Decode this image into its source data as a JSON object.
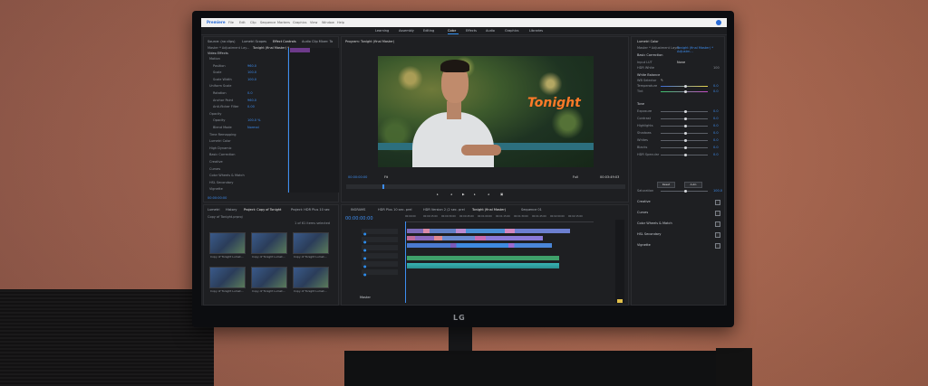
{
  "app": {
    "name": "Premiere",
    "menu": [
      "File",
      "Edit",
      "Clip",
      "Sequence",
      "Markers",
      "Graphics",
      "View",
      "Window",
      "Help"
    ]
  },
  "workspaces": [
    "Learning",
    "Assembly",
    "Editing",
    "Color",
    "Effects",
    "Audio",
    "Graphics",
    "Libraries"
  ],
  "active_workspace": "Color",
  "effect_controls": {
    "tabs": [
      "Source: (no clips)",
      "Lumetri Scopes",
      "Effect Controls",
      "Audio Clip Mixer: To"
    ],
    "master": "Master * Adjustment Lay...",
    "clip": "Tonight (final Master) *",
    "section": "Video Effects",
    "rows": [
      {
        "label": "Motion",
        "value": ""
      },
      {
        "label": "Position",
        "value": "960.0"
      },
      {
        "label": "Scale",
        "value": "100.0"
      },
      {
        "label": "Scale Width",
        "value": "100.0"
      },
      {
        "label": "Uniform Scale",
        "value": ""
      },
      {
        "label": "Rotation",
        "value": "0.0"
      },
      {
        "label": "Anchor Point",
        "value": "960.0"
      },
      {
        "label": "Anti-flicker Filter",
        "value": "0.00"
      },
      {
        "label": "Opacity",
        "value": ""
      },
      {
        "label": "Opacity",
        "value": "100.0 %"
      },
      {
        "label": "Blend Mode",
        "value": "Normal"
      },
      {
        "label": "Time Remapping",
        "value": ""
      },
      {
        "label": "Lumetri Color",
        "value": ""
      },
      {
        "label": "High Dynamic",
        "value": ""
      },
      {
        "label": "Basic Correction",
        "value": ""
      },
      {
        "label": "Creative",
        "value": ""
      },
      {
        "label": "Curves",
        "value": ""
      },
      {
        "label": "Color Wheels & Match",
        "value": ""
      },
      {
        "label": "HSL Secondary",
        "value": ""
      },
      {
        "label": "Vignette",
        "value": ""
      }
    ],
    "timecode": "00:00:00:00"
  },
  "program": {
    "title": "Program: Tonight (final Master)",
    "overlay_title": "Tonight",
    "timecode_left": "00:00:00:00",
    "timecode_right": "00:03:49:03",
    "fit": "Fit",
    "quality": "Full"
  },
  "lumetri": {
    "title": "Lumetri Color",
    "master": "Master * Adjustment Layer",
    "clip": "Tonight (final Master) * Adjustm...",
    "sections": [
      "Basic Correction",
      "Creative",
      "Curves",
      "Color Wheels & Match",
      "HSL Secondary",
      "Vignette"
    ],
    "input_lut": {
      "label": "Input LUT",
      "value": "None"
    },
    "hdr_white": {
      "label": "HDR White",
      "value": "100"
    },
    "white_balance": "White Balance",
    "wb_selector": "WB Selector",
    "tone": "Tone",
    "sliders": [
      {
        "label": "Temperature",
        "value": "0.0",
        "pos": 0.5
      },
      {
        "label": "Tint",
        "value": "0.0",
        "pos": 0.5
      },
      {
        "label": "Exposure",
        "value": "0.0",
        "pos": 0.5
      },
      {
        "label": "Contrast",
        "value": "0.0",
        "pos": 0.5
      },
      {
        "label": "Highlights",
        "value": "0.0",
        "pos": 0.5
      },
      {
        "label": "Shadows",
        "value": "0.0",
        "pos": 0.5
      },
      {
        "label": "Whites",
        "value": "0.0",
        "pos": 0.5
      },
      {
        "label": "Blacks",
        "value": "0.0",
        "pos": 0.5
      },
      {
        "label": "HDR Specular",
        "value": "0.0",
        "pos": 0.5
      }
    ],
    "reset": "Reset",
    "auto": "Auto",
    "saturation": {
      "label": "Saturation",
      "value": "100.0"
    }
  },
  "project": {
    "tabs": [
      "Lumetri",
      "History",
      "Project: Copy of Tonight",
      "Project: HDR Plus 10 sec"
    ],
    "file": "Copy of Tonight.prproj",
    "count": "1 of 61 items selected",
    "thumbs": [
      "Copy of Tonight Lumet...",
      "Copy of Tonight Lumet...",
      "Copy of Tonight Lumet...",
      "Copy of Tonight Lumet...",
      "Copy of Tonight Lumet...",
      "Copy of Tonight Lumet..."
    ]
  },
  "timeline": {
    "tabs": [
      "INGRAMS",
      "HDR Plus 10 sec. prel",
      "HDR Version 2 (2 sec. prel",
      "Tonight (final Master)",
      "Sequence 01"
    ],
    "timecode": "00:00:00:00",
    "ruler": [
      "00:00:00",
      "00:00:15:00",
      "00:00:30:00",
      "00:00:45:00",
      "00:01:00:00",
      "00:01:15:00",
      "00:01:30:00",
      "00:01:45:00",
      "00:02:00:00",
      "00:02:15:00"
    ],
    "master_label": "Master"
  },
  "brand": "LG",
  "colors": {
    "accent": "#2d8ceb",
    "value": "#3d8df0",
    "title": "#ff7a28"
  }
}
